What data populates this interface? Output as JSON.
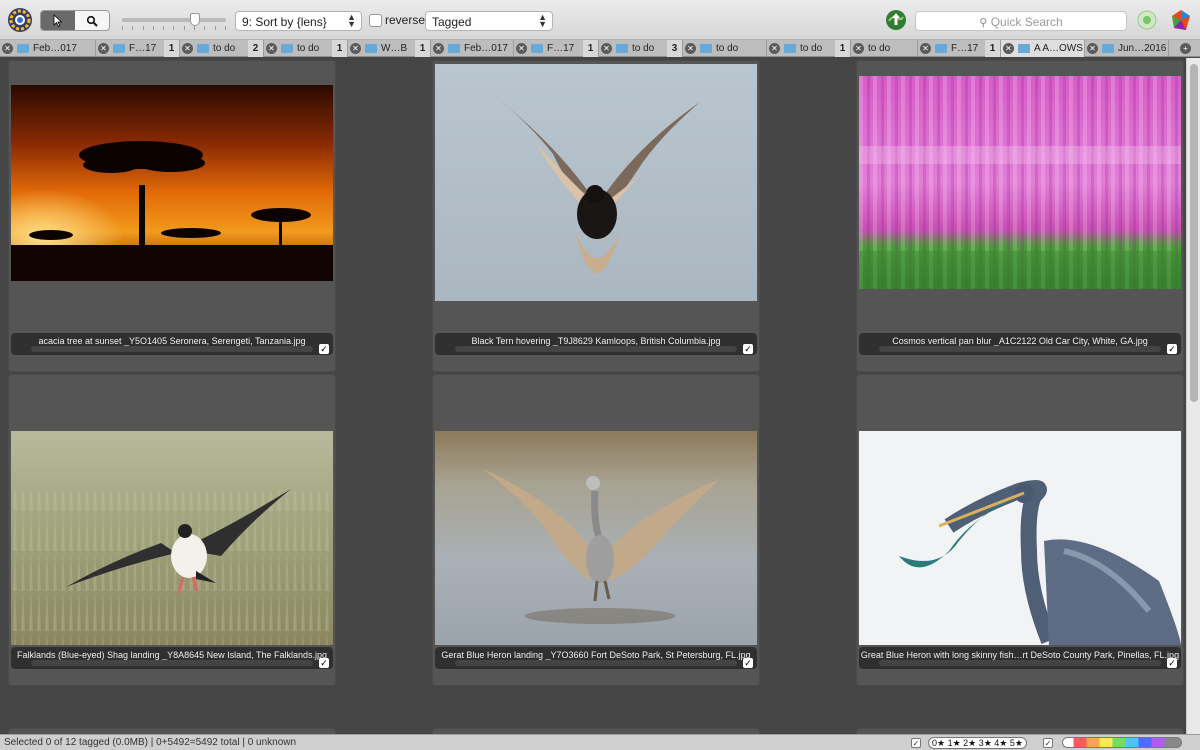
{
  "toolbar": {
    "select_tool": "pointer",
    "zoom_tool": "magnifier",
    "sort_select": "9: Sort by {lens}",
    "reverse_label": "reverse",
    "filter_select": "Tagged",
    "search_placeholder": "Quick Search",
    "colors": {
      "accent": "#6a6a6a",
      "folder": "#68a9dc",
      "green": "#4caf50"
    }
  },
  "tabs": [
    {
      "label": "Feb…017",
      "count": ""
    },
    {
      "label": "F…17",
      "count": "1"
    },
    {
      "label": "to do",
      "count": "2"
    },
    {
      "label": "to do",
      "count": "1"
    },
    {
      "label": "W…B",
      "count": "1"
    },
    {
      "label": "Feb…017",
      "count": ""
    },
    {
      "label": "F…17",
      "count": "1"
    },
    {
      "label": "to do",
      "count": "3"
    },
    {
      "label": "to do",
      "count": ""
    },
    {
      "label": "to do",
      "count": "1"
    },
    {
      "label": "to do",
      "count": ""
    },
    {
      "label": "F…17",
      "count": "1"
    },
    {
      "label": "A A…OWS",
      "count": ""
    },
    {
      "label": "Jun…2016",
      "count": ""
    }
  ],
  "photos": [
    {
      "caption": "acacia tree at sunset _Y5O1405  Seronera, Serengeti, Tanzania.jpg",
      "checked": true
    },
    {
      "caption": "Black Tern hovering _T9J8629 Kamloops, British Columbia.jpg",
      "checked": true
    },
    {
      "caption": "Cosmos vertical pan blur  _A1C2122  Old Car City, White, GA.jpg",
      "checked": true
    },
    {
      "caption": "Falklands (Blue-eyed) Shag landing _Y8A8645 New Island, The Falklands.jpg",
      "checked": true
    },
    {
      "caption": "Gerat Blue Heron landing _Y7O3660  Fort DeSoto Park, St Petersburg, FL.jpg",
      "checked": true
    },
    {
      "caption": "Great Blue Heron with long skinny fish…rt DeSoto County Park, Pinellas, FL.jpg",
      "checked": true
    }
  ],
  "status": {
    "text": "Selected 0 of 12 tagged (0.0MB) | 0+5492=5492 total | 0 unknown",
    "stars": "0★ 1★ 2★ 3★ 4★ 5★",
    "check_mark": "✓"
  }
}
